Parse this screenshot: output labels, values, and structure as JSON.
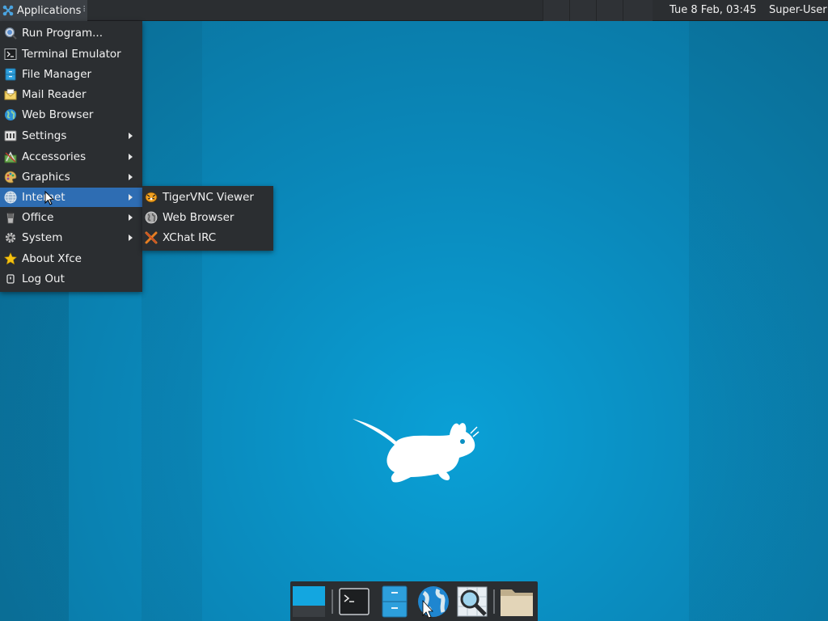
{
  "panel": {
    "applications_label": "Applications",
    "grip": "⠇",
    "clock": "Tue  8 Feb, 03:45",
    "user": "Super-User"
  },
  "main_menu": {
    "items": [
      {
        "label": "Run Program...",
        "icon": "run-icon",
        "submenu": false
      },
      {
        "label": "Terminal Emulator",
        "icon": "terminal-icon",
        "submenu": false
      },
      {
        "label": "File Manager",
        "icon": "file-manager-icon",
        "submenu": false
      },
      {
        "label": "Mail Reader",
        "icon": "mail-icon",
        "submenu": false
      },
      {
        "label": "Web Browser",
        "icon": "web-browser-icon",
        "submenu": false
      },
      {
        "label": "Settings",
        "icon": "settings-icon",
        "submenu": true
      },
      {
        "label": "Accessories",
        "icon": "accessories-icon",
        "submenu": true
      },
      {
        "label": "Graphics",
        "icon": "graphics-icon",
        "submenu": true
      },
      {
        "label": "Internet",
        "icon": "internet-icon",
        "submenu": true,
        "active": true
      },
      {
        "label": "Office",
        "icon": "office-icon",
        "submenu": true
      },
      {
        "label": "System",
        "icon": "gear-icon",
        "submenu": true
      },
      {
        "label": "About Xfce",
        "icon": "star-icon",
        "submenu": false
      },
      {
        "label": "Log Out",
        "icon": "logout-icon",
        "submenu": false
      }
    ]
  },
  "internet_submenu": {
    "items": [
      {
        "label": "TigerVNC Viewer",
        "icon": "tigervnc-icon"
      },
      {
        "label": "Web Browser",
        "icon": "web-browser-icon"
      },
      {
        "label": "XChat IRC",
        "icon": "xchat-icon"
      }
    ]
  },
  "dock": {
    "items": [
      {
        "name": "show-desktop",
        "icon": "show-desktop-icon"
      },
      {
        "name": "terminal",
        "icon": "terminal-icon"
      },
      {
        "name": "file-manager",
        "icon": "file-manager-icon"
      },
      {
        "name": "web-browser",
        "icon": "web-browser-icon"
      },
      {
        "name": "app-finder",
        "icon": "search-icon"
      },
      {
        "name": "home-folder",
        "icon": "folder-icon"
      }
    ]
  },
  "colors": {
    "panel_bg": "#2b2e31",
    "menu_highlight": "#2e6db3",
    "desktop_blue": "#0a8fc2"
  }
}
